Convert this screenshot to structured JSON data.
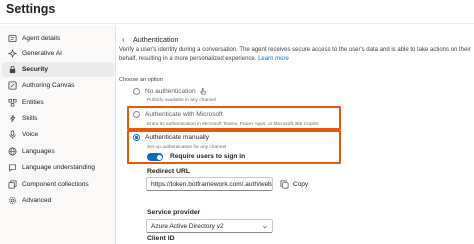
{
  "window": {
    "title": "Settings"
  },
  "sidebar": {
    "items": [
      {
        "label": "Agent details",
        "icon": "agent-details-icon"
      },
      {
        "label": "Generative AI",
        "icon": "generative-ai-icon"
      },
      {
        "label": "Security",
        "icon": "lock-icon",
        "active": true
      },
      {
        "label": "Authoring Canvas",
        "icon": "authoring-canvas-icon"
      },
      {
        "label": "Entities",
        "icon": "entities-icon"
      },
      {
        "label": "Skills",
        "icon": "skills-icon"
      },
      {
        "label": "Voice",
        "icon": "voice-icon"
      },
      {
        "label": "Languages",
        "icon": "languages-icon"
      },
      {
        "label": "Language understanding",
        "icon": "language-understanding-icon"
      },
      {
        "label": "Component collections",
        "icon": "component-collections-icon"
      },
      {
        "label": "Advanced",
        "icon": "advanced-icon"
      }
    ]
  },
  "main": {
    "back_glyph": "‹",
    "section_title": "Authentication",
    "description": "Verify a user's identity during a conversation. The agent receives secure access to the user's data and is able to take actions on their behalf, resulting in a more personalized experience.",
    "learn_more": "Learn more",
    "choose_option": "Choose an option",
    "options": [
      {
        "label": "No authentication",
        "sublabel": "Publicly available in any channel",
        "checked": false
      },
      {
        "label": "Authenticate with Microsoft",
        "sublabel": "Entra ID authentication in Microsoft Teams, Power Apps, or Microsoft 365 Copilot",
        "checked": false
      },
      {
        "label": "Authenticate manually",
        "sublabel": "Set up authentication for any channel",
        "checked": true
      }
    ],
    "require_sign_in": {
      "label": "Require users to sign in",
      "on": true
    },
    "redirect_url": {
      "label": "Redirect URL",
      "value": "https://token.botframework.com/.auth/web/re",
      "copy_label": "Copy"
    },
    "service_provider": {
      "label": "Service provider",
      "value": "Azure Active Directory v2"
    },
    "client_id": {
      "label": "Client ID"
    }
  },
  "colors": {
    "accent": "#0f6cbd",
    "highlight": "#e8570a"
  }
}
